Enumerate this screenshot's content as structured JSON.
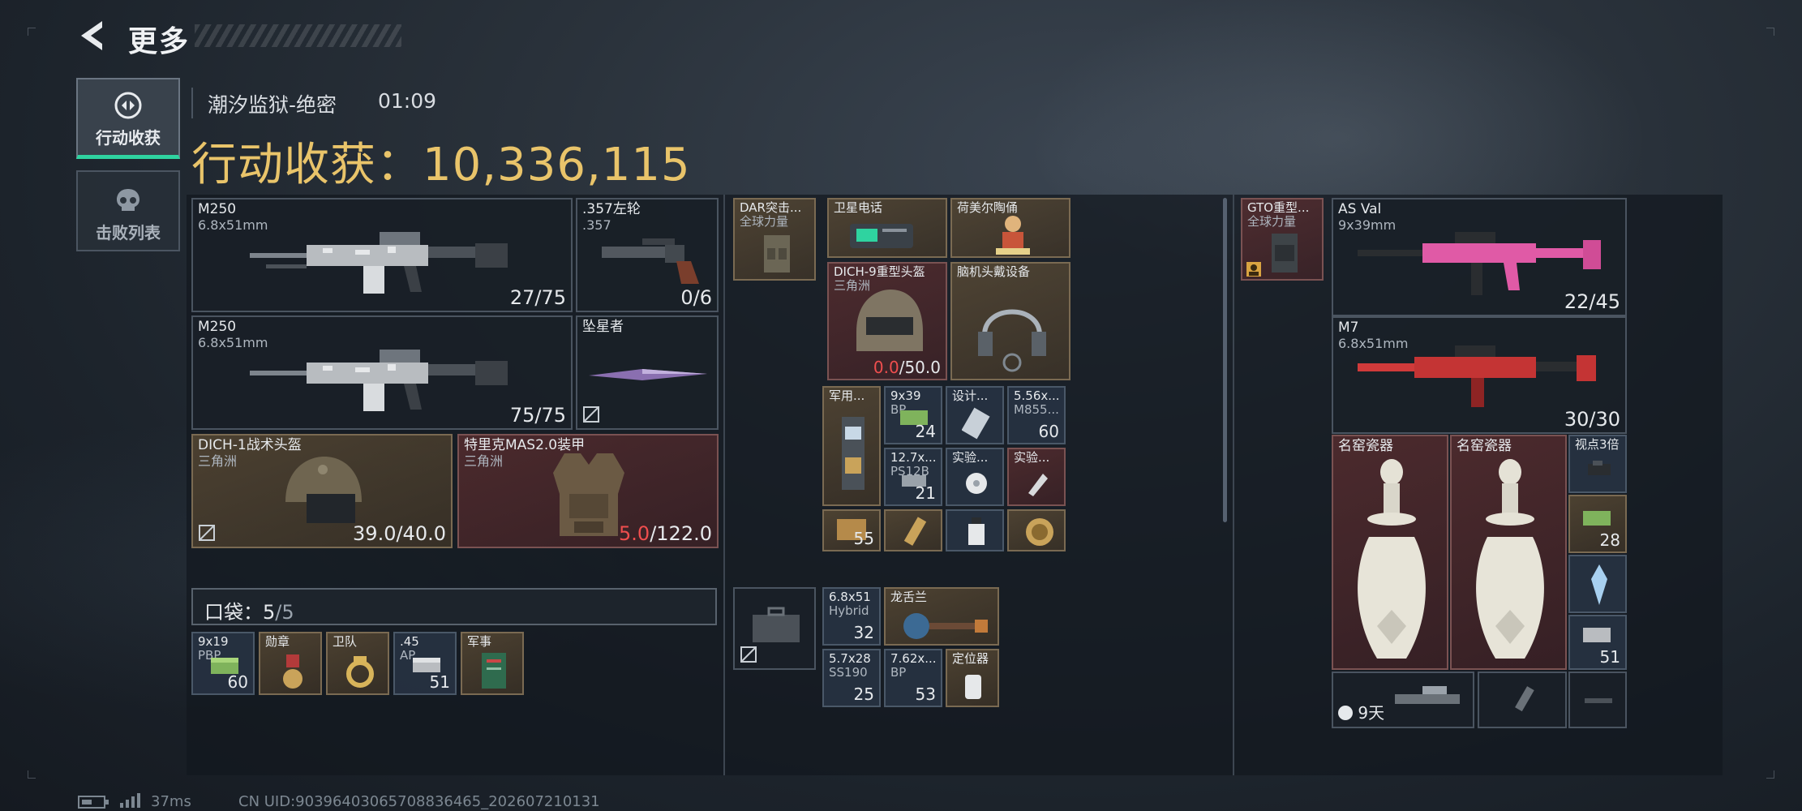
{
  "header": {
    "title": "更多"
  },
  "side_tabs": [
    {
      "label": "行动收获",
      "icon": "operation-icon",
      "active": true
    },
    {
      "label": "击败列表",
      "icon": "skull-icon",
      "active": false
    }
  ],
  "operation": {
    "map_mode": "潮汐监狱-绝密",
    "time": "01:09",
    "haul_label": "行动收获：",
    "haul_value": "10,336,115"
  },
  "equipment": {
    "primary_1": {
      "name": "M250",
      "caliber": "6.8x51mm",
      "ammo": "27/75"
    },
    "sidearm": {
      "name": ".357左轮",
      "caliber": ".357",
      "ammo": "0/6"
    },
    "primary_2": {
      "name": "M250",
      "caliber": "6.8x51mm",
      "ammo": "75/75"
    },
    "melee": {
      "name": "坠星者"
    },
    "helmet": {
      "name": "DICH-1战术头盔",
      "origin": "三角洲",
      "durability": "39.0/40.0"
    },
    "armor": {
      "name": "特里克MAS2.0装甲",
      "origin": "三角洲",
      "durability_current": "5.0",
      "durability_max": "/122.0"
    }
  },
  "pocket": {
    "label": "口袋：",
    "count": "5",
    "capacity": "/5",
    "items": [
      {
        "name": "9x19",
        "sub": "PBP",
        "count": "60"
      },
      {
        "name": "勋章",
        "sub": "",
        "count": ""
      },
      {
        "name": "卫队",
        "sub": "",
        "count": ""
      },
      {
        "name": ".45",
        "sub": "AP",
        "count": "51"
      },
      {
        "name": "军事",
        "sub": "",
        "count": ""
      }
    ]
  },
  "backpack": {
    "rig": {
      "name": "DAR突击...",
      "sub": "全球力量"
    },
    "items": [
      {
        "name": "卫星电话"
      },
      {
        "name": "荷美尔陶俑"
      },
      {
        "name": "DICH-9重型头盔",
        "sub": "三角洲",
        "durability_current": "0.0",
        "durability_max": "/50.0"
      },
      {
        "name": "脑机头戴设备"
      },
      {
        "name": "军用..."
      },
      {
        "name": "9x39",
        "sub": "BP",
        "count": "24"
      },
      {
        "name": "设计..."
      },
      {
        "name": "5.56x...",
        "sub": "M855...",
        "count": "60"
      },
      {
        "name": "12.7x...",
        "sub": "PS12B",
        "count": "21"
      },
      {
        "name": "实验..."
      },
      {
        "name": "实验..."
      },
      {
        "name": "",
        "count": "55"
      }
    ],
    "case_items": [
      {
        "name": "6.8x51",
        "sub": "Hybrid",
        "count": "32"
      },
      {
        "name": "龙舌兰"
      },
      {
        "name": "5.7x28",
        "sub": "SS190",
        "count": "25"
      },
      {
        "name": "7.62x...",
        "sub": "BP",
        "count": "53"
      },
      {
        "name": "定位器"
      }
    ]
  },
  "stash": {
    "rig": {
      "name": "GTO重型...",
      "sub": "全球力量"
    },
    "weapon_1": {
      "name": "AS Val",
      "caliber": "9x39mm",
      "ammo": "22/45"
    },
    "weapon_2": {
      "name": "M7",
      "caliber": "6.8x51mm",
      "ammo": "30/30"
    },
    "vase_1": {
      "name": "名窑瓷器"
    },
    "vase_2": {
      "name": "名窑瓷器"
    },
    "scope": {
      "name": "视点3倍"
    },
    "small_1": {
      "count": "28"
    },
    "small_2": {
      "count": ""
    },
    "small_3": {
      "count": "51"
    },
    "rental": {
      "days": "9天"
    }
  },
  "status_bar": {
    "ping": "37ms",
    "uid": "CN UID:9039640306570883646​5_202607210131"
  },
  "colors": {
    "accent_gold": "#e9c46a",
    "accent_green": "#2fd3a0",
    "broken_red": "#ef4e4e"
  }
}
